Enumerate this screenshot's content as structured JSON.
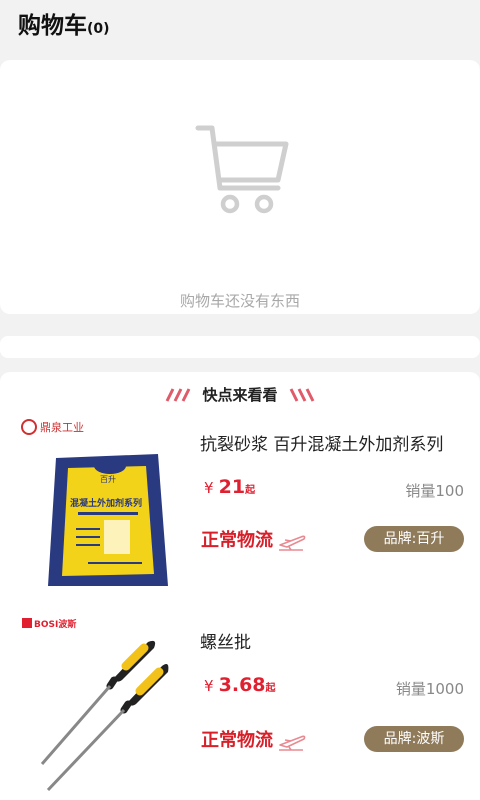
{
  "header": {
    "title": "购物车",
    "count": "(0)"
  },
  "empty_cart": {
    "message": "购物车还没有东西"
  },
  "recommend": {
    "title": "快点来看看",
    "products": [
      {
        "name": "抗裂砂浆 百升混凝土外加剂系列",
        "currency": "¥",
        "price": "21",
        "price_suffix": "起",
        "sales": "销量100",
        "logistics": "正常物流",
        "brand": "品牌:百升",
        "image": {
          "watermark": "鼎泉工业",
          "package_brand": "百升",
          "package_title": "混凝土外加剂系列"
        }
      },
      {
        "name": "螺丝批",
        "currency": "¥",
        "price": "3.68",
        "price_suffix": "起",
        "sales": "销量1000",
        "logistics": "正常物流",
        "brand": "品牌:波斯",
        "image": {
          "logo": "BOSI波斯"
        }
      }
    ]
  },
  "colors": {
    "price_red": "#e02030",
    "logistics_red": "#d8202a",
    "brand_badge": "#8f7a5a",
    "background": "#f2f2f2"
  }
}
